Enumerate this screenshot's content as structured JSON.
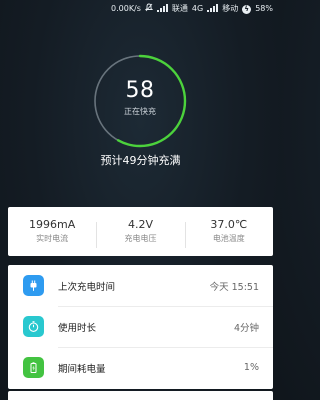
{
  "status_bar": {
    "network_speed": "0.00K/s",
    "carrier1": "联通",
    "carrier1_net": "4G",
    "carrier2": "移动",
    "battery_percent": "58%"
  },
  "charging": {
    "level": "58",
    "level_fraction": 0.58,
    "status_text": "正在快充",
    "estimate_text": "预计49分钟充满",
    "accent_color": "#4cd23c"
  },
  "stats": [
    {
      "value": "1996mA",
      "label": "实时电流"
    },
    {
      "value": "4.2V",
      "label": "充电电压"
    },
    {
      "value": "37.0℃",
      "label": "电池温度"
    }
  ],
  "details": [
    {
      "label": "上次充电时间",
      "value": "今天 15:51",
      "icon": "plug-icon",
      "color": "#2e9bf0"
    },
    {
      "label": "使用时长",
      "value": "4分钟",
      "icon": "stopwatch-icon",
      "color": "#29c8cf"
    },
    {
      "label": "期间耗电量",
      "value": "1%",
      "icon": "battery-charge-icon",
      "color": "#43c341"
    }
  ]
}
